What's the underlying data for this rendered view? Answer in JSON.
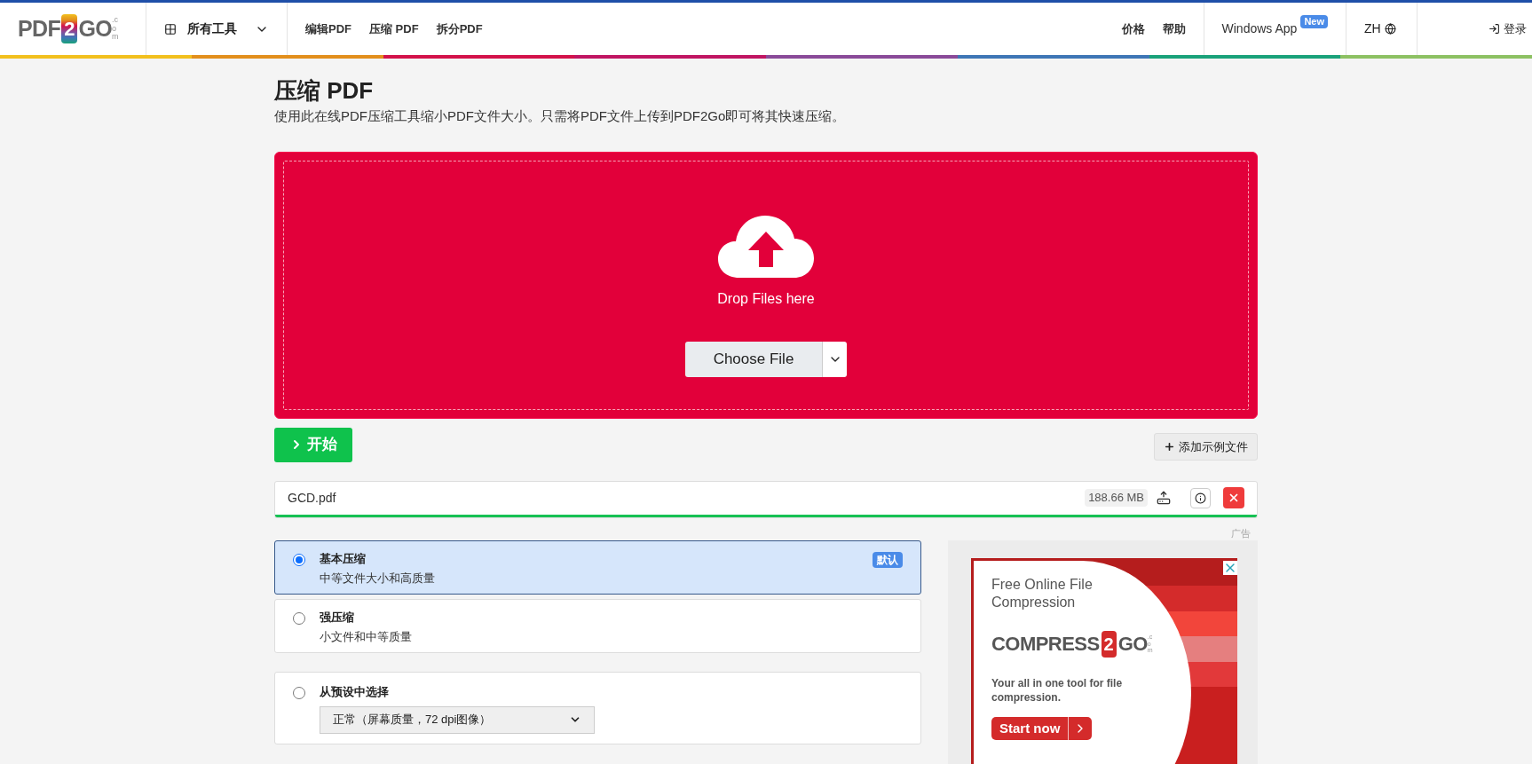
{
  "header": {
    "logo": {
      "left": "PDF",
      "badge": "2",
      "right": "GO",
      "suffix": ".com"
    },
    "tools_menu": "所有工具",
    "nav": [
      "编辑PDF",
      "压缩 PDF",
      "拆分PDF"
    ],
    "right_links": [
      "价格",
      "帮助"
    ],
    "app_link": {
      "label": "Windows App",
      "badge": "New"
    },
    "language": "ZH",
    "login": "登录"
  },
  "page": {
    "title": "压缩 PDF",
    "subtitle": "使用此在线PDF压缩工具缩小PDF文件大小。只需将PDF文件上传到PDF2Go即可将其快速压缩。"
  },
  "upload": {
    "drop_text": "Drop Files here",
    "choose_button": "Choose File"
  },
  "actions": {
    "start": "开始",
    "add_sample": "添加示例文件"
  },
  "files": [
    {
      "name": "GCD.pdf",
      "size": "188.66 MB",
      "level": 1
    }
  ],
  "options": [
    {
      "title": "基本压缩",
      "description": "中等文件大小和高质量",
      "badge": "默认",
      "selected": true
    },
    {
      "title": "强压缩",
      "description": "小文件和中等质量",
      "selected": false
    }
  ],
  "preset_option": {
    "title": "从预设中选择",
    "selected": false,
    "value": "正常（屏幕质量，72 dpi图像）"
  },
  "ad": {
    "label": "广告",
    "headline": "Free Online File Compression",
    "logo": {
      "left": "COMPRESS",
      "badge": "2",
      "right": "GO",
      "suffix": ".com"
    },
    "tagline": "Your all in one tool for file compression.",
    "cta": "Start now"
  }
}
